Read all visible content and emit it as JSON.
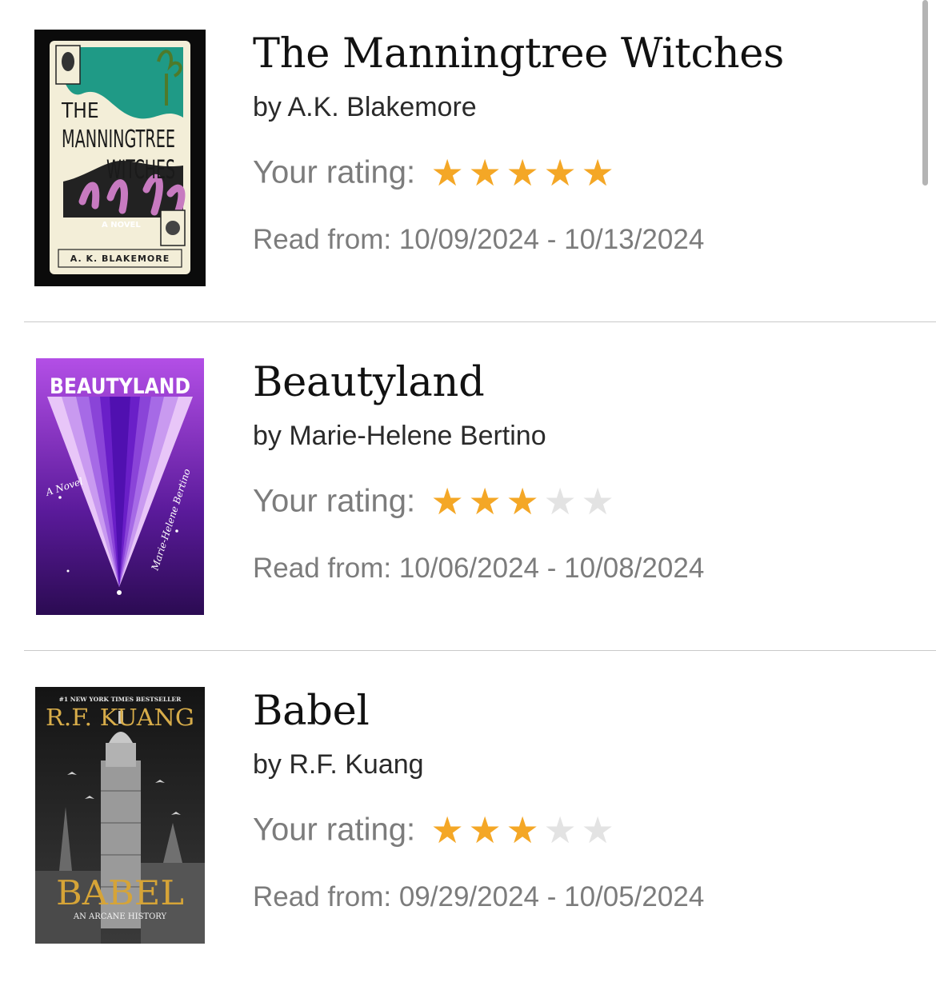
{
  "books": [
    {
      "title": "The Manningtree Witches",
      "author": "by A.K. Blakemore",
      "rating_label": "Your rating:",
      "rating": 5,
      "rating_max": 5,
      "dates": "Read from: 10/09/2024 - 10/13/2024",
      "cover": {
        "line1": "THE",
        "line2": "MANNINGTREE",
        "line3": "WITCHES",
        "tag": "A NOVEL",
        "author": "A. K. BLAKEMORE"
      }
    },
    {
      "title": "Beautyland",
      "author": "by Marie-Helene Bertino",
      "rating_label": "Your rating:",
      "rating": 3,
      "rating_max": 5,
      "dates": "Read from: 10/06/2024 - 10/08/2024",
      "cover": {
        "title": "BEAUTYLAND",
        "tag": "A Novel",
        "author": "Marie-Helene Bertino"
      }
    },
    {
      "title": "Babel",
      "author": "by R.F. Kuang",
      "rating_label": "Your rating:",
      "rating": 3,
      "rating_max": 5,
      "dates": "Read from: 09/29/2024 - 10/05/2024",
      "cover": {
        "top": "#1 NEW YORK TIMES BESTSELLER",
        "author": "R.F. KUANG",
        "title": "BABEL",
        "subtitle": "AN ARCANE HISTORY"
      }
    }
  ],
  "colors": {
    "star_on": "#f4a726",
    "star_off": "#e3e3e3",
    "meta_text": "#7c7c7c",
    "divider": "#c9c9c9"
  }
}
